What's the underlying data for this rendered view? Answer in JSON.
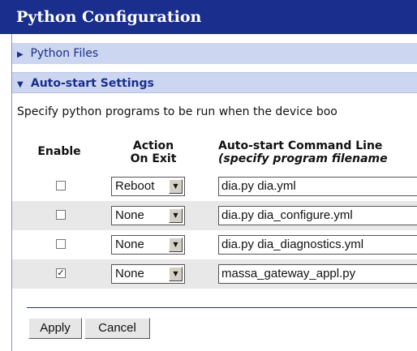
{
  "page": {
    "title": "Python Configuration"
  },
  "sections": {
    "python_files": {
      "label": "Python Files",
      "expanded": false,
      "icon": "triangle-right-icon"
    },
    "auto_start": {
      "label": "Auto-start Settings",
      "expanded": true,
      "icon": "triangle-down-icon"
    }
  },
  "description": "Specify python programs to be run when the device boo",
  "table": {
    "headers": {
      "enable": "Enable",
      "action_line1": "Action",
      "action_line2": "On Exit",
      "cmd_line1": "Auto-start Command Line",
      "cmd_line2": "(specify program filename"
    },
    "rows": [
      {
        "enabled": false,
        "check_mark": "",
        "action": "Reboot",
        "command": "dia.py dia.yml"
      },
      {
        "enabled": false,
        "check_mark": "",
        "action": "None",
        "command": "dia.py dia_configure.yml"
      },
      {
        "enabled": false,
        "check_mark": "",
        "action": "None",
        "command": "dia.py dia_diagnostics.yml"
      },
      {
        "enabled": true,
        "check_mark": "✓",
        "action": "None",
        "command": "massa_gateway_appl.py"
      }
    ]
  },
  "buttons": {
    "apply": "Apply",
    "cancel": "Cancel"
  },
  "colors": {
    "title_bar": "#1a2e8e",
    "section_bg": "#ccd6f0",
    "row_shade": "#e8e8e8"
  }
}
